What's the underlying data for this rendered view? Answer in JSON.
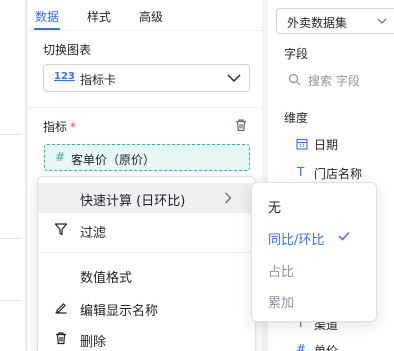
{
  "colors": {
    "accent": "#3370ff",
    "metric": "#2fb5a5",
    "required": "#f54a45",
    "muted": "#8f959e"
  },
  "config_panel": {
    "tabs": [
      {
        "label": "数据"
      },
      {
        "label": "样式"
      },
      {
        "label": "高级"
      }
    ],
    "active_tab": 0,
    "switch_chart_label": "切换图表",
    "chart_type": {
      "icon_text": "123",
      "value": "指标卡"
    },
    "metric_label": "指标",
    "required_mark": "*",
    "metric_field": {
      "icon": "#",
      "label": "客单价（原价）"
    }
  },
  "field_panel": {
    "dataset": "外卖数据集",
    "fields_label": "字段",
    "search_placeholder": "搜索 字段",
    "dimension_label": "维度",
    "dimensions": [
      {
        "icon": "calendar-icon",
        "label": "日期"
      },
      {
        "icon": "T",
        "label": "门店名称"
      },
      {
        "icon": "T",
        "label": "渠道"
      },
      {
        "icon": "#",
        "label": "单价"
      }
    ]
  },
  "context_menu": {
    "items": [
      {
        "label": "快速计算 (日环比)",
        "icon": "none",
        "has_submenu": true,
        "hovered": true
      },
      {
        "label": "过滤",
        "icon": "filter-icon"
      },
      {
        "label": "数值格式",
        "icon": "none"
      },
      {
        "label": "编辑显示名称",
        "icon": "edit-icon"
      },
      {
        "label": "删除",
        "icon": "trash-icon"
      }
    ]
  },
  "quick_calc_submenu": {
    "items": [
      {
        "label": "无",
        "state": "normal"
      },
      {
        "label": "同比/环比",
        "state": "selected"
      },
      {
        "label": "占比",
        "state": "disabled"
      },
      {
        "label": "累加",
        "state": "disabled"
      }
    ]
  }
}
